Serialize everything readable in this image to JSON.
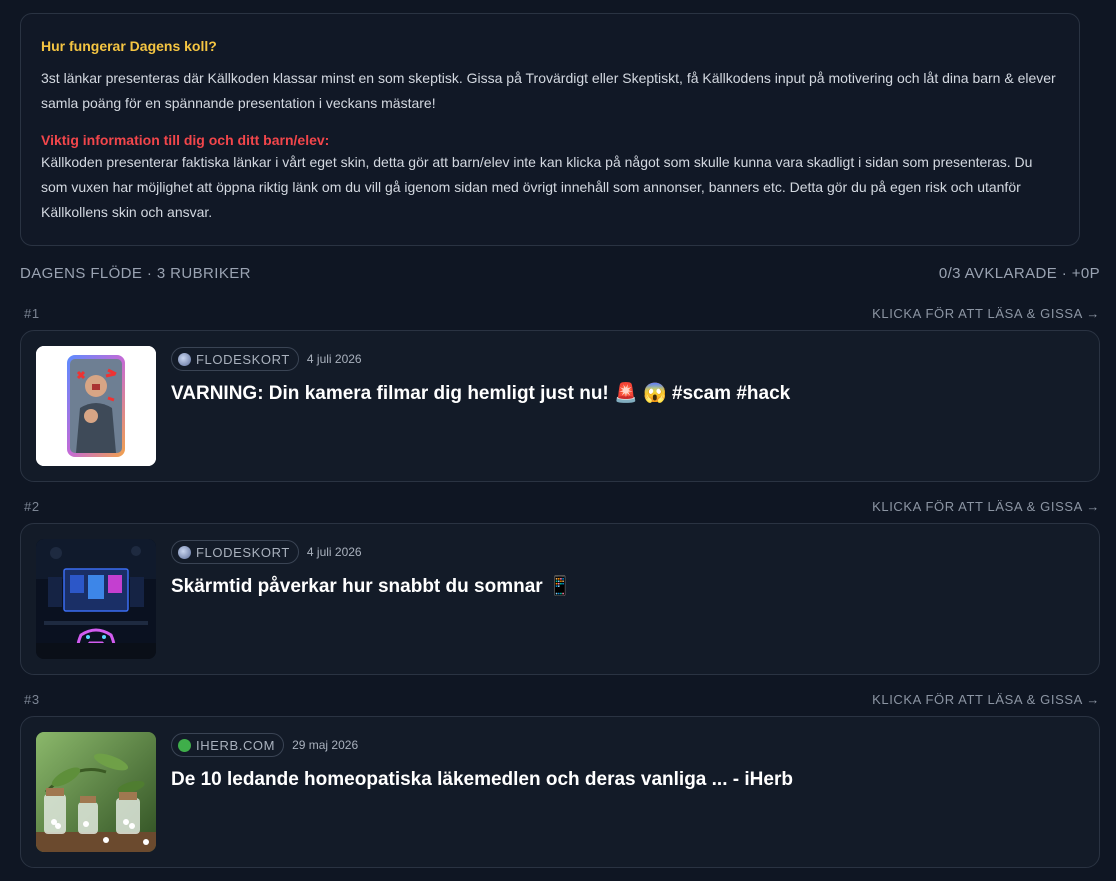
{
  "info": {
    "title": "Hur fungerar Dagens koll?",
    "text": "3st länkar presenteras där Källkoden klassar minst en som skeptisk. Gissa på Trovärdigt eller Skeptiskt, få Källkodens input på motivering och låt dina barn & elever samla poäng för en spännande presentation i veckans mästare!",
    "warning_title": "Viktig information till dig och ditt barn/elev:",
    "warning_text": "Källkoden presenterar faktiska länkar i vårt eget skin, detta gör att barn/elev inte kan klicka på något som skulle kunna vara skadligt i sidan som presenteras. Du som vuxen har möjlighet att öppna riktig länk om du vill gå igenom sidan med övrigt innehåll som annonser, banners etc. Detta gör du på egen risk och utanför Källkollens skin och ansvar."
  },
  "feed": {
    "title": "DAGENS FLÖDE · 3 RUBRIKER",
    "progress": "0/3 AVKLARADE · +0P"
  },
  "items": [
    {
      "number": "#1",
      "cta": "KLICKA FÖR ATT LÄSA & GISSA →",
      "source": "FLODESKORT",
      "source_icon": "globe-icon",
      "date": "4 juli 2026",
      "headline": "VARNING: Din kamera filmar dig hemligt just nu! 🚨 😱 #scam #hack"
    },
    {
      "number": "#2",
      "cta": "KLICKA FÖR ATT LÄSA & GISSA →",
      "source": "FLODESKORT",
      "source_icon": "globe-icon",
      "date": "4 juli 2026",
      "headline": "Skärmtid påverkar hur snabbt du somnar 📱"
    },
    {
      "number": "#3",
      "cta": "KLICKA FÖR ATT LÄSA & GISSA →",
      "source": "IHERB.COM",
      "source_icon": "leaf-icon",
      "date": "29 maj 2026",
      "headline": "De 10 ledande homeopatiska läkemedlen och deras vanliga ... - iHerb"
    }
  ],
  "colors": {
    "background": "#0f1623",
    "info_title": "#f5c542",
    "warning_title": "#f2464b",
    "card_border": "#2a3342"
  }
}
